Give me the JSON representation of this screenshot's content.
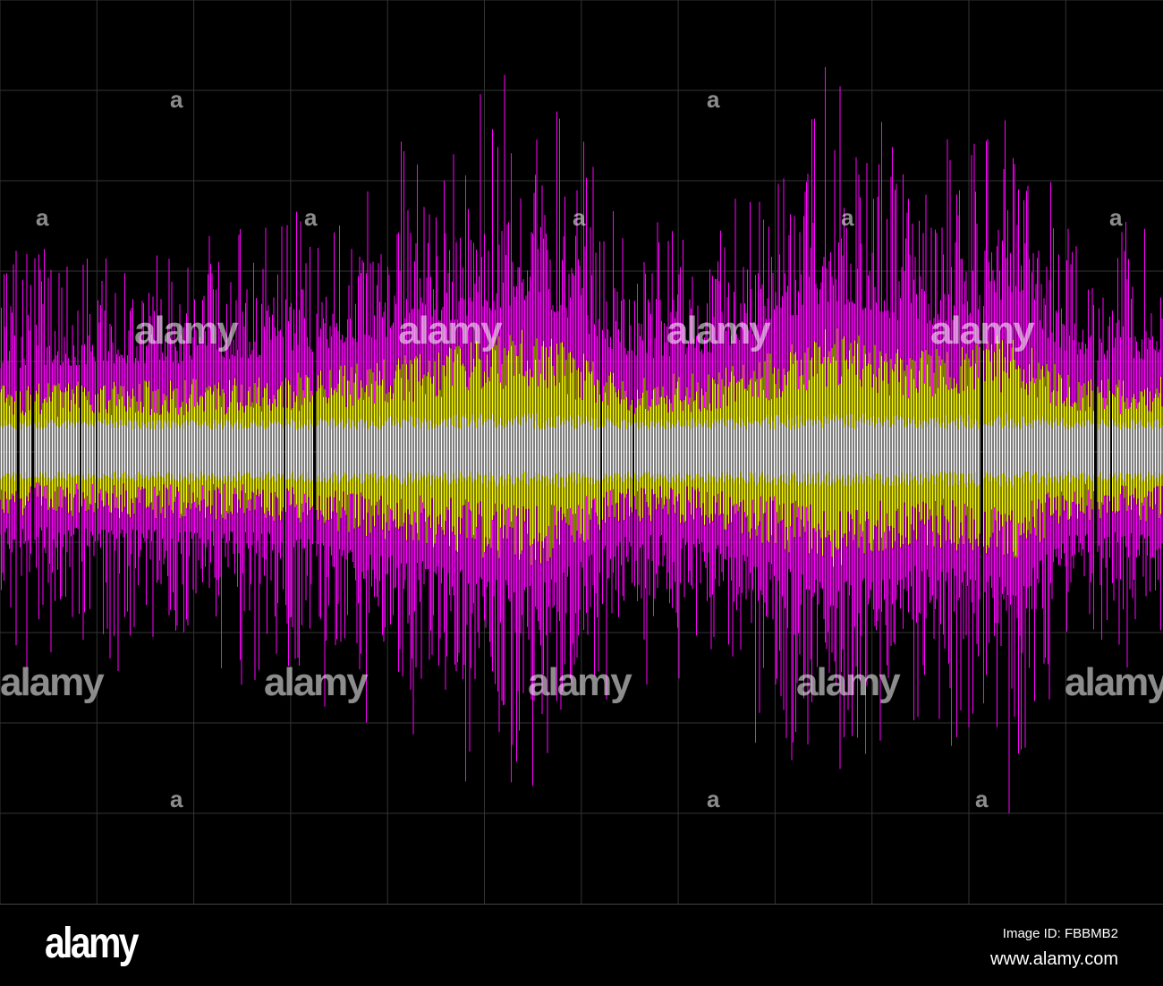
{
  "footer": {
    "logo": "alamy",
    "image_id": "Image ID: FBBMB2",
    "url": "www.alamy.com"
  },
  "watermark": {
    "text": "alamy",
    "mark": "a"
  },
  "colors": {
    "background": "#000000",
    "grid": "#333333",
    "outer_wave": "#ff00ff",
    "middle_wave": "#ffff00",
    "inner_wave": "#ffffff"
  }
}
